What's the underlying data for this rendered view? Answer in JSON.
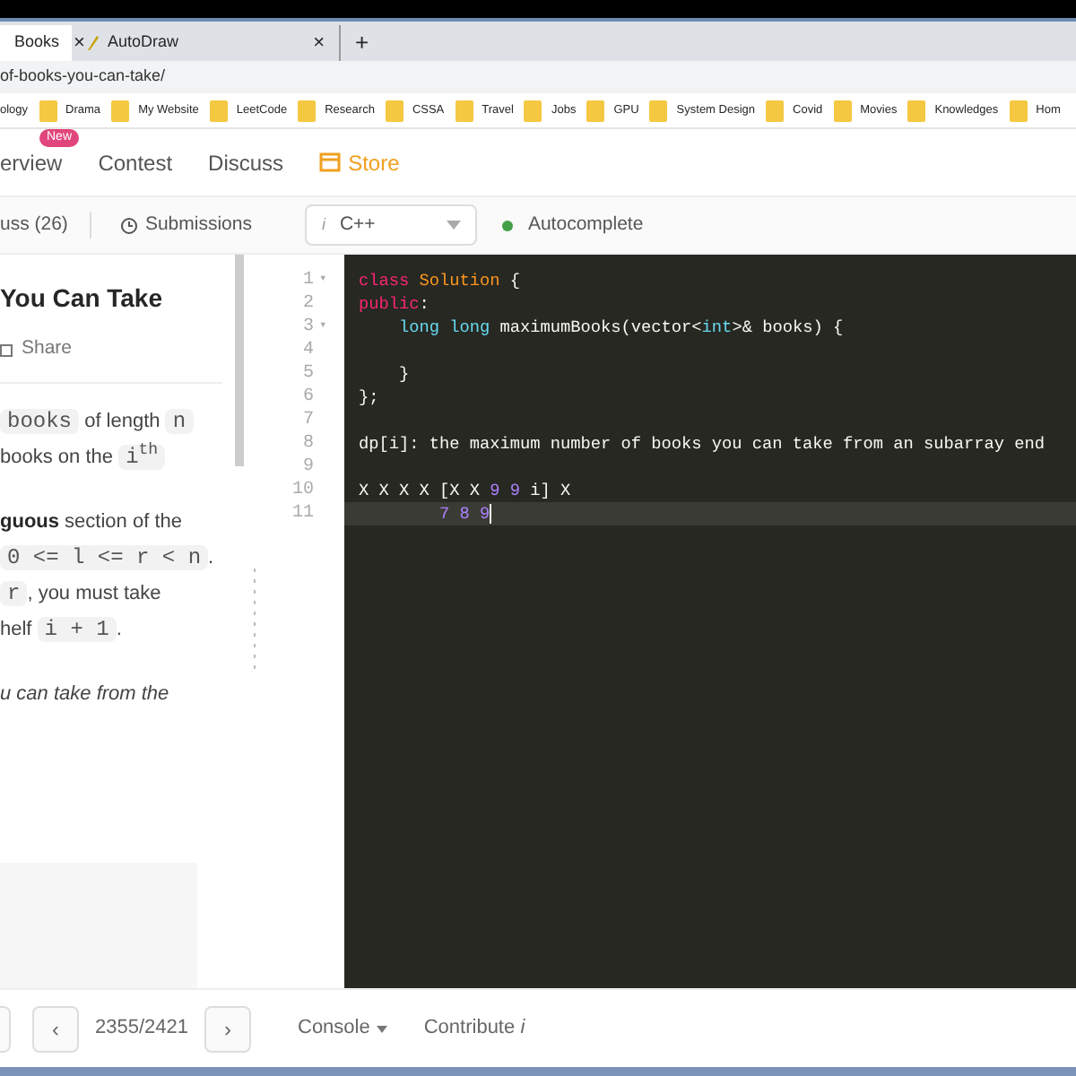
{
  "browser": {
    "tabs": [
      {
        "title": "Books",
        "selected": true,
        "close": "×"
      },
      {
        "title": "AutoDraw",
        "selected": false,
        "close": "×"
      }
    ],
    "new_tab": "+",
    "url": "of-books-you-can-take/",
    "bookmarks": [
      {
        "label": "ology",
        "folder": false
      },
      {
        "label": "Drama",
        "folder": true
      },
      {
        "label": "My Website",
        "folder": true
      },
      {
        "label": "LeetCode",
        "folder": true
      },
      {
        "label": "Research",
        "folder": true
      },
      {
        "label": "CSSA",
        "folder": true
      },
      {
        "label": "Travel",
        "folder": true
      },
      {
        "label": "Jobs",
        "folder": true
      },
      {
        "label": "GPU",
        "folder": true
      },
      {
        "label": "System Design",
        "folder": true
      },
      {
        "label": "Covid",
        "folder": true
      },
      {
        "label": "Movies",
        "folder": true
      },
      {
        "label": "Knowledges",
        "folder": true
      },
      {
        "label": "Hom",
        "folder": true
      }
    ]
  },
  "nav": [
    {
      "label": "erview",
      "badge": "New",
      "kind": "plain"
    },
    {
      "label": "Contest",
      "kind": "plain"
    },
    {
      "label": "Discuss",
      "kind": "plain"
    },
    {
      "label": "Store",
      "kind": "store"
    }
  ],
  "toolbar": {
    "discuss": "uss (26)",
    "submissions": "Submissions",
    "language": {
      "icon": "i",
      "value": "C++"
    },
    "autocomplete": {
      "label": "Autocomplete",
      "on": true
    }
  },
  "problem": {
    "title": "You Can Take",
    "share": "Share",
    "paragraphs": [
      [
        [
          {
            "kind": "code",
            "text": "books"
          },
          {
            "kind": "text",
            "text": " of length "
          },
          {
            "kind": "code",
            "text": "n"
          }
        ],
        [
          {
            "kind": "text",
            "text": "books on the "
          },
          {
            "kind": "code",
            "text": "i$^{th}$"
          }
        ]
      ],
      [
        [
          {
            "kind": "bold",
            "text": "guous"
          },
          {
            "kind": "text",
            "text": " section of the"
          }
        ],
        [
          {
            "kind": "code",
            "text": "0 <= l <= r < n"
          },
          {
            "kind": "text",
            "text": "."
          }
        ],
        [
          {
            "kind": "code",
            "text": "r"
          },
          {
            "kind": "text",
            "text": ", you must take"
          }
        ],
        [
          {
            "kind": "text",
            "text": "helf "
          },
          {
            "kind": "code",
            "text": "i + 1"
          },
          {
            "kind": "text",
            "text": "."
          }
        ]
      ],
      [
        [
          {
            "kind": "italic",
            "text": "u can take from the"
          }
        ]
      ]
    ]
  },
  "editor": {
    "lines": [
      {
        "number": "1",
        "fold": "▾",
        "active": false,
        "tokens": [
          {
            "kind": "keyword",
            "text": "class"
          },
          {
            "kind": "class",
            "text": " Solution"
          },
          {
            "kind": "plain",
            "text": " {"
          }
        ]
      },
      {
        "number": "2",
        "active": false,
        "tokens": [
          {
            "kind": "keyword",
            "text": "public"
          },
          {
            "kind": "plain",
            "text": ":"
          }
        ]
      },
      {
        "number": "3",
        "fold": "▾",
        "active": false,
        "tokens": [
          {
            "kind": "type",
            "text": "    long long"
          },
          {
            "kind": "plain",
            "text": " maximumBooks(vector<"
          },
          {
            "kind": "type",
            "text": "int"
          },
          {
            "kind": "plain",
            "text": ">& books) {"
          }
        ]
      },
      {
        "number": "4",
        "active": false
      },
      {
        "number": "5",
        "active": false,
        "tokens": [
          {
            "kind": "plain",
            "text": "    }"
          }
        ]
      },
      {
        "number": "6",
        "active": false,
        "tokens": [
          {
            "kind": "plain",
            "text": "};"
          }
        ]
      },
      {
        "number": "7",
        "active": false
      },
      {
        "number": "8",
        "active": false,
        "tokens": [
          {
            "kind": "plain",
            "text": "dp[i]: the maximum number of books you can take from an subarray end"
          }
        ]
      },
      {
        "number": "9",
        "active": false
      },
      {
        "number": "10",
        "active": false,
        "tokens": [
          {
            "kind": "plain",
            "text": "X X X X [X X "
          },
          {
            "kind": "number",
            "text": "9 9"
          },
          {
            "kind": "plain",
            "text": " i] X"
          }
        ]
      },
      {
        "number": "11",
        "active": true,
        "tokens": [
          {
            "kind": "number",
            "text": "        7 8 9"
          }
        ]
      }
    ]
  },
  "footer": {
    "prev": "‹",
    "counter": "2355/2421",
    "next": "›",
    "console": "Console",
    "contribute": "Contribute",
    "contribute_icon": "i"
  }
}
